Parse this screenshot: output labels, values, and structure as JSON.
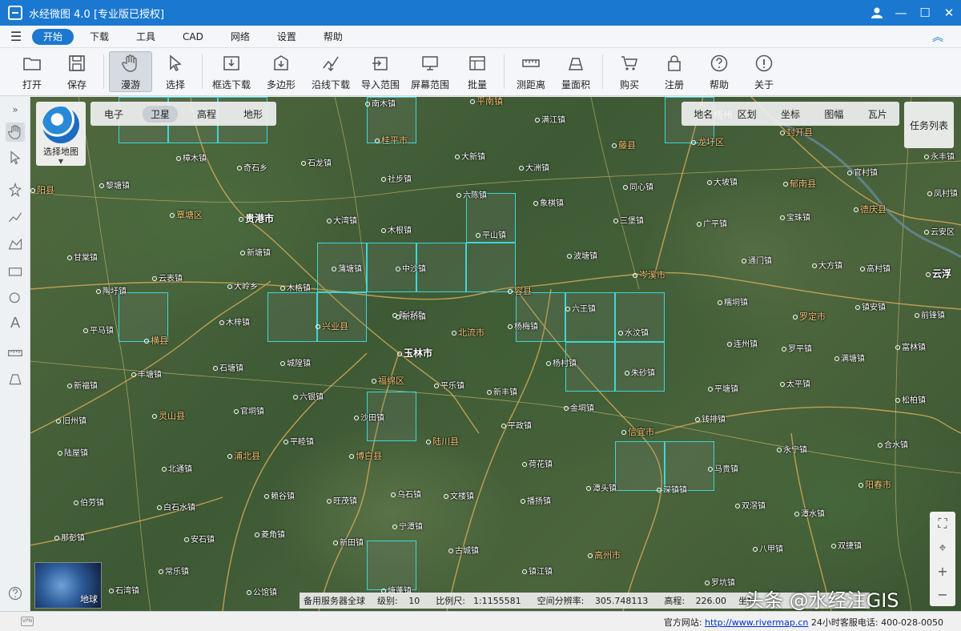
{
  "window": {
    "title": "水经微图 4.0 [专业版已授权]"
  },
  "menu": [
    "开始",
    "下载",
    "工具",
    "CAD",
    "网络",
    "设置",
    "帮助"
  ],
  "toolbar": {
    "open": "打开",
    "save": "保存",
    "pan": "漫游",
    "select": "选择",
    "box_download": "框选下载",
    "polygon": "多边形",
    "line_download": "沿线下载",
    "import_range": "导入范围",
    "screen_range": "屏幕范围",
    "batch": "批量",
    "measure_distance": "测距离",
    "measure_area": "量面积",
    "buy": "购买",
    "register": "注册",
    "help": "帮助",
    "about": "关于"
  },
  "map": {
    "source_tabs": [
      "电子",
      "卫星",
      "高程",
      "地形"
    ],
    "selected_source": "卫星",
    "select_map_label": "选择地图",
    "right_panel": [
      "地名",
      "区划",
      "坐标",
      "图幅",
      "瓦片"
    ],
    "task_list": "任务列表",
    "minimap_label": "地球",
    "watermark": "头条 @水经注GIS",
    "places": [
      {
        "name": "南木镇"
      },
      {
        "name": "平南镇"
      },
      {
        "name": "满江镇"
      },
      {
        "name": "藤县"
      },
      {
        "name": "龙圩区"
      },
      {
        "name": "封开县"
      },
      {
        "name": "桂平市"
      },
      {
        "name": "大新镇"
      },
      {
        "name": "大洲镇"
      },
      {
        "name": "樟木镇"
      },
      {
        "name": "石龙镇"
      },
      {
        "name": "奇石乡"
      },
      {
        "name": "社步镇"
      },
      {
        "name": "黎塘镇"
      },
      {
        "name": "同心镇"
      },
      {
        "name": "大坡镇"
      },
      {
        "name": "郁南县"
      },
      {
        "name": "官村镇"
      },
      {
        "name": "六陈镇"
      },
      {
        "name": "象棋镇"
      },
      {
        "name": "贵港市"
      },
      {
        "name": "覃塘区"
      },
      {
        "name": "大湾镇"
      },
      {
        "name": "木根镇"
      },
      {
        "name": "平山镇"
      },
      {
        "name": "三堡镇"
      },
      {
        "name": "广平镇"
      },
      {
        "name": "宝珠镇"
      },
      {
        "name": "德庆县"
      },
      {
        "name": "甘棠镇"
      },
      {
        "name": "新塘镇"
      },
      {
        "name": "蒲塘镇"
      },
      {
        "name": "中沙镇"
      },
      {
        "name": "波塘镇"
      },
      {
        "name": "通门镇"
      },
      {
        "name": "大方镇"
      },
      {
        "name": "高村镇"
      },
      {
        "name": "云表镇"
      },
      {
        "name": "大岭乡"
      },
      {
        "name": "木格镇"
      },
      {
        "name": "容县"
      },
      {
        "name": "岑溪市"
      },
      {
        "name": "陶圩镇"
      },
      {
        "name": "新圩镇"
      },
      {
        "name": "六王镇"
      },
      {
        "name": "糯垌镇"
      },
      {
        "name": "罗定市"
      },
      {
        "name": "镇安镇"
      },
      {
        "name": "平马镇"
      },
      {
        "name": "横县"
      },
      {
        "name": "木梓镇"
      },
      {
        "name": "兴业县"
      },
      {
        "name": "新桥镇"
      },
      {
        "name": "北流市"
      },
      {
        "name": "杨梅镇"
      },
      {
        "name": "水汶镇"
      },
      {
        "name": "连州镇"
      },
      {
        "name": "罗平镇"
      },
      {
        "name": "满塘镇"
      },
      {
        "name": "富林镇"
      },
      {
        "name": "玉林市"
      },
      {
        "name": "杨村镇"
      },
      {
        "name": "朱砂镇"
      },
      {
        "name": "丰塘镇"
      },
      {
        "name": "石塘镇"
      },
      {
        "name": "城隍镇"
      },
      {
        "name": "福绵区"
      },
      {
        "name": "平乐镇"
      },
      {
        "name": "新丰镇"
      },
      {
        "name": "平塘镇"
      },
      {
        "name": "太平镇"
      },
      {
        "name": "新福镇"
      },
      {
        "name": "六银镇"
      },
      {
        "name": "金垌镇"
      },
      {
        "name": "松柏镇"
      },
      {
        "name": "旧州镇"
      },
      {
        "name": "灵山县"
      },
      {
        "name": "官垌镇"
      },
      {
        "name": "沙田镇"
      },
      {
        "name": "平政镇"
      },
      {
        "name": "信宜市"
      },
      {
        "name": "钱排镇"
      },
      {
        "name": "陆屋镇"
      },
      {
        "name": "平睦镇"
      },
      {
        "name": "陆川县"
      },
      {
        "name": "永宁镇"
      },
      {
        "name": "合水镇"
      },
      {
        "name": "浦北县"
      },
      {
        "name": "博白县"
      },
      {
        "name": "北通镇"
      },
      {
        "name": "荷花镇"
      },
      {
        "name": "马贵镇"
      },
      {
        "name": "阳春市"
      },
      {
        "name": "赖谷镇"
      },
      {
        "name": "乌石镇"
      },
      {
        "name": "文楼镇"
      },
      {
        "name": "播扬镇"
      },
      {
        "name": "潭头镇"
      },
      {
        "name": "深镇镇"
      },
      {
        "name": "伯劳镇"
      },
      {
        "name": "白石水镇"
      },
      {
        "name": "旺茂镇"
      },
      {
        "name": "双滘镇"
      },
      {
        "name": "潭水镇"
      },
      {
        "name": "宁潭镇"
      },
      {
        "name": "那彭镇"
      },
      {
        "name": "菱角镇"
      },
      {
        "name": "安石镇"
      },
      {
        "name": "新田镇"
      },
      {
        "name": "古城镇"
      },
      {
        "name": "高州市"
      },
      {
        "name": "八甲镇"
      },
      {
        "name": "双捷镇"
      },
      {
        "name": "常乐镇"
      },
      {
        "name": "镇江镇"
      },
      {
        "name": "罗坑镇"
      },
      {
        "name": "石湾镇"
      },
      {
        "name": "公馆镇"
      },
      {
        "name": "塘蓬镇"
      },
      {
        "name": "阳县"
      },
      {
        "name": "云安区"
      },
      {
        "name": "前锋镇"
      },
      {
        "name": "永丰镇"
      },
      {
        "name": "凤村镇"
      },
      {
        "name": "云浮"
      },
      {
        "name": "梧州"
      }
    ]
  },
  "map_status": {
    "server": "备用服务器全球",
    "level_label": "级别:",
    "level": "10",
    "scale_label": "比例尺:",
    "scale": "1:1155581",
    "resolution_label": "空间分辨率:",
    "resolution": "305.748113",
    "elevation_label": "高程:",
    "elevation": "226.00",
    "coord_label": "坐标"
  },
  "statusbar": {
    "website_label": "官方网站:",
    "website": "http://www.rivermap.cn",
    "hotline": "24小时客服电话: 400-028-0050"
  }
}
